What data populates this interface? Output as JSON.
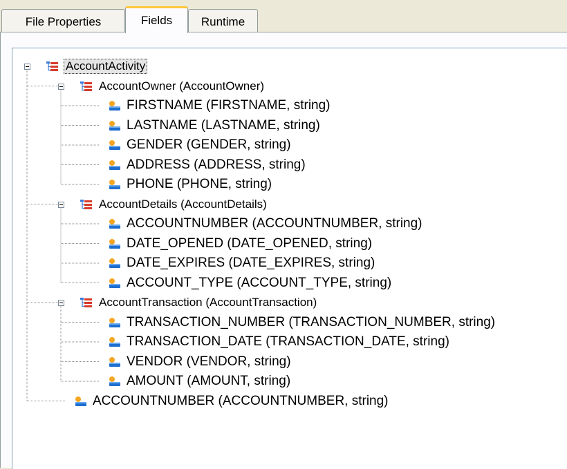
{
  "tabs": [
    {
      "label": "File Properties",
      "active": false
    },
    {
      "label": "Fields",
      "active": true
    },
    {
      "label": "Runtime",
      "active": false
    }
  ],
  "tree": {
    "root": "AccountActivity",
    "groups": [
      {
        "label": "AccountOwner (AccountOwner)",
        "fields": [
          "FIRSTNAME (FIRSTNAME, string)",
          "LASTNAME (LASTNAME, string)",
          "GENDER (GENDER, string)",
          "ADDRESS (ADDRESS, string)",
          "PHONE (PHONE, string)"
        ]
      },
      {
        "label": "AccountDetails (AccountDetails)",
        "fields": [
          "ACCOUNTNUMBER  (ACCOUNTNUMBER,  string)",
          "DATE_OPENED (DATE_OPENED, string)",
          "DATE_EXPIRES (DATE_EXPIRES, string)",
          "ACCOUNT_TYPE  (ACCOUNT_TYPE, string)"
        ]
      },
      {
        "label": "AccountTransaction (AccountTransaction)",
        "fields": [
          "TRANSACTION_NUMBER  (TRANSACTION_NUMBER,  string)",
          "TRANSACTION_DATE  (TRANSACTION_DATE, string)",
          "VENDOR (VENDOR, string)",
          "AMOUNT (AMOUNT, string)"
        ]
      }
    ],
    "root_fields": [
      "ACCOUNTNUMBER  (ACCOUNTNUMBER,  string)"
    ]
  },
  "icons": {
    "record": "record-icon",
    "field": "field-icon"
  },
  "colors": {
    "record_icon": "#d83a2a",
    "record_icon_secondary": "#3a78d8",
    "field_icon_top": "#f5a623",
    "field_icon_bottom": "#1f6fd1",
    "active_tab_accent": "#ffc83c"
  }
}
